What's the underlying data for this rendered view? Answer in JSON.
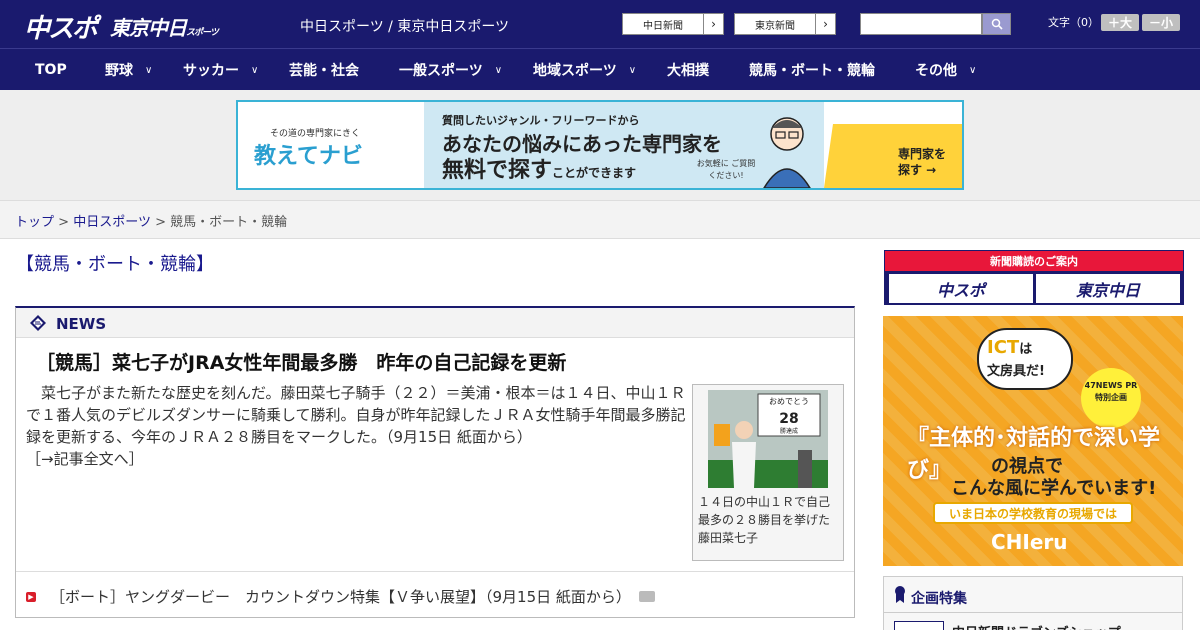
{
  "header": {
    "logo_chuspo": "中スポ",
    "logo_tokyo": "東京中日",
    "logo_tokyo_small": "スポーツ",
    "site_links": "中日スポーツ / 東京中日スポーツ",
    "btn_chunichi": "中日新聞",
    "btn_tokyo": "東京新聞",
    "font_size_label": "文字（0）",
    "font_larger": "＋大",
    "font_smaller": "－小"
  },
  "nav": {
    "items": [
      {
        "label": "TOP",
        "has_menu": false
      },
      {
        "label": "野球",
        "has_menu": true
      },
      {
        "label": "サッカー",
        "has_menu": true
      },
      {
        "label": "芸能・社会",
        "has_menu": false
      },
      {
        "label": "一般スポーツ",
        "has_menu": true
      },
      {
        "label": "地域スポーツ",
        "has_menu": true
      },
      {
        "label": "大相撲",
        "has_menu": false
      },
      {
        "label": "競馬・ボート・競輪",
        "has_menu": false
      },
      {
        "label": "その他",
        "has_menu": true
      }
    ]
  },
  "banner": {
    "left_small": "その道の専門家にきく",
    "left_big": "教えてナビ",
    "line1": "質問したいジャンル・フリーワードから",
    "line2": "あなたの悩みにあった専門家を",
    "line3": "無料で探す",
    "line3_tail": "ことができます",
    "note": "お気軽に ご質問ください!",
    "cta": "専門家を 探す →"
  },
  "breadcrumb": {
    "home": "トップ",
    "section": "中日スポーツ",
    "current": "競馬・ボート・競輪",
    "sep": ">"
  },
  "page": {
    "heading": "【競馬・ボート・競輪】"
  },
  "news": {
    "box_title": "NEWS",
    "article_title": "［競馬］菜七子がJRA女性年間最多勝　昨年の自己記録を更新",
    "article_body": "菜七子がまた新たな歴史を刻んだ。藤田菜七子騎手（２２）＝美浦・根本＝は１４日、中山１Ｒで１番人気のデビルズダンサーに騎乗して勝利。自身が昨年記録したＪＲＡ女性騎手年間最多勝記録を更新する、今年のＪＲＡ２８勝目をマークした。（9月15日 紙面から）",
    "article_link": "［→記事全文へ］",
    "photo_caption": "１４日の中山１Ｒで自己最多の２８勝目を挙げた藤田菜七子",
    "photo_board_1": "おめでとう",
    "photo_board_2": "28",
    "photo_board_3": "勝達成",
    "sub_item": "［ボート］ヤングダービー　カウントダウン特集【Ｖ争い展望】（9月15日 紙面から）"
  },
  "sidebar": {
    "subscribe_title": "新聞購読のご案内",
    "subscribe_btn1": "中スポ",
    "subscribe_btn2": "東京中日",
    "ad_bubble_1": "ICT",
    "ad_bubble_2": "は",
    "ad_bubble_3": "文房具だ!",
    "ad_pr": "47NEWS PR 特別企画",
    "ad_head1": "『主体的･対話的で深い学び』",
    "ad_head2": "の視点で",
    "ad_head3": "こんな風に学んでいます!",
    "ad_ribbon": "いま日本の学校教育の現場では",
    "ad_brand": "CHIeru",
    "kikaku_title": "企画特集",
    "kikaku_item": "中日新聞ドラゴンズショップ"
  },
  "colors": {
    "brand_navy": "#1a1a6e",
    "accent_red": "#e8173a",
    "banner_cyan": "#3ab3d6"
  }
}
